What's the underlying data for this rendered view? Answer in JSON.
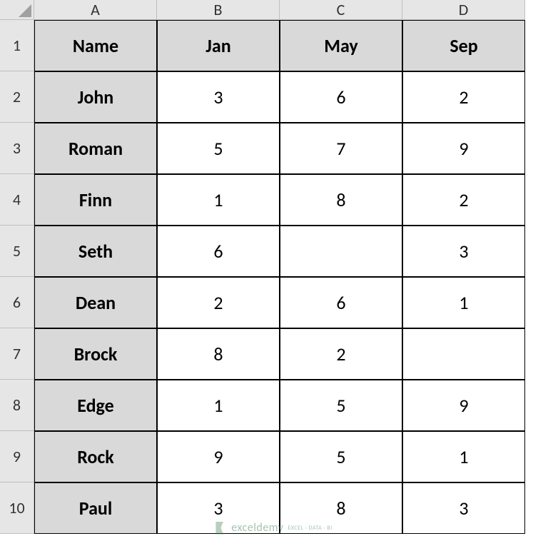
{
  "columns": [
    "A",
    "B",
    "C",
    "D"
  ],
  "rows": [
    "1",
    "2",
    "3",
    "4",
    "5",
    "6",
    "7",
    "8",
    "9",
    "10"
  ],
  "headers": {
    "A": "Name",
    "B": "Jan",
    "C": "May",
    "D": "Sep"
  },
  "data": [
    {
      "name": "John",
      "jan": "3",
      "may": "6",
      "sep": "2"
    },
    {
      "name": "Roman",
      "jan": "5",
      "may": "7",
      "sep": "9"
    },
    {
      "name": "Finn",
      "jan": "1",
      "may": "8",
      "sep": "2"
    },
    {
      "name": "Seth",
      "jan": "6",
      "may": "",
      "sep": "3"
    },
    {
      "name": "Dean",
      "jan": "2",
      "may": "6",
      "sep": "1"
    },
    {
      "name": "Brock",
      "jan": "8",
      "may": "2",
      "sep": ""
    },
    {
      "name": "Edge",
      "jan": "1",
      "may": "5",
      "sep": "9"
    },
    {
      "name": "Rock",
      "jan": "9",
      "may": "5",
      "sep": "1"
    },
    {
      "name": "Paul",
      "jan": "3",
      "may": "8",
      "sep": "3"
    }
  ],
  "watermark": {
    "text": "exceldemy",
    "sub": "EXCEL · DATA · BI"
  }
}
